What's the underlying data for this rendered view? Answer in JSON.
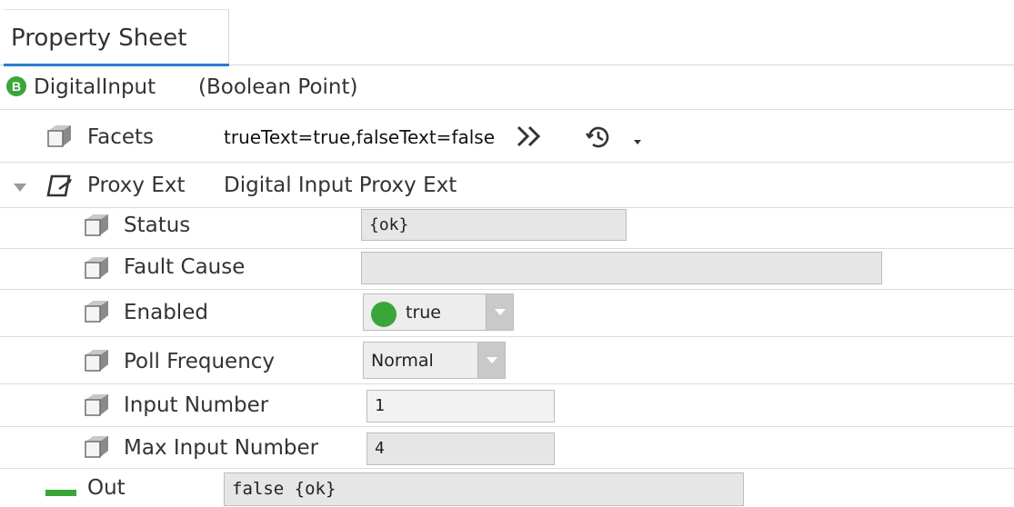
{
  "tab": {
    "label": "Property Sheet"
  },
  "root": {
    "badge": "B",
    "name": "DigitalInput",
    "type": "(Boolean Point)"
  },
  "facets": {
    "label": "Facets",
    "value": "trueText=true,falseText=false"
  },
  "proxy_ext": {
    "label": "Proxy Ext",
    "value": "Digital Input Proxy Ext"
  },
  "status": {
    "label": "Status",
    "value": "{ok}"
  },
  "fault_cause": {
    "label": "Fault Cause",
    "value": ""
  },
  "enabled": {
    "label": "Enabled",
    "value": "true",
    "color": "#3aa63a"
  },
  "poll_frequency": {
    "label": "Poll Frequency",
    "value": "Normal"
  },
  "input_number": {
    "label": "Input Number",
    "value": "1"
  },
  "max_input_number": {
    "label": "Max Input Number",
    "value": "4"
  },
  "out": {
    "label": "Out",
    "value": "false {ok}",
    "color": "#3aa63a"
  }
}
